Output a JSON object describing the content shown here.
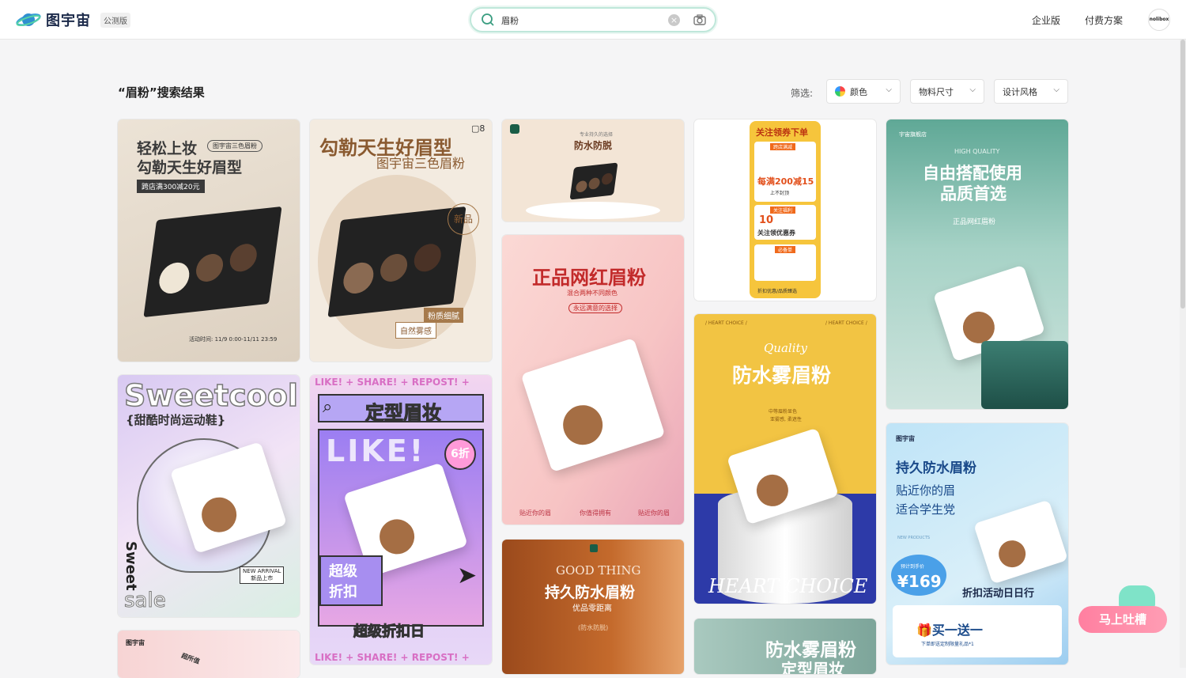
{
  "header": {
    "logo_text": "图宇宙",
    "beta_badge": "公测版",
    "search_query": "眉粉",
    "nav": [
      "企业版",
      "付费方案"
    ],
    "avatar_text": "nolibox"
  },
  "results": {
    "title": "“眉粉”搜索结果",
    "filter_label": "筛选:",
    "filters": [
      "颜色",
      "物料尺寸",
      "设计风格"
    ]
  },
  "cards": {
    "c1": {
      "title1": "轻松上妆",
      "title2": "勾勒天生好眉型",
      "tag": "图宇宙三色眉粉",
      "promo": "跨店满300减20元",
      "time": "活动时间: 11/9 0:00-11/11 23:59"
    },
    "c2": {
      "title1": "勾勒天生好眉型",
      "title2": "图宇宙三色眉粉",
      "badge": "新品",
      "label1": "粉质细腻",
      "label2": "自然雾感",
      "page_count": "8"
    },
    "c3": {
      "sub": "专业持久的选择",
      "title": "防水防脱"
    },
    "c4": {
      "head": "关注领券下单",
      "a": "跨店满减",
      "b": "每满200减15",
      "c": "上不封顶",
      "d": "关注福利",
      "e": "10",
      "f": "关注领优惠券",
      "g": "必备单",
      "h": "折扣优惠/品质臻选"
    },
    "c5": {
      "shop": "宇宙旗舰店",
      "hq": "HIGH QUALITY",
      "title1": "自由搭配使用",
      "title2": "品质首选",
      "sub": "正品网红眉粉"
    },
    "c6": {
      "title": "正品网红眉粉",
      "sub1": "混合两种不同颜色",
      "sub2": "永远满意的选择",
      "f1": "贴近你的眉",
      "f2": "你值得拥有",
      "f3": "贴近你的眉"
    },
    "c7": {
      "brand": "Sweetcool",
      "sub": "{甜酷时尚运动鞋}",
      "side": "Sweet",
      "bottom": "sale",
      "na": "NEW ARRIVAL",
      "nb": "新品上市"
    },
    "c8": {
      "top": "LIKE! + SHARE! + REPOST! +",
      "title": "定型眉妆",
      "big": "LIKE!",
      "discount": "6折",
      "b1": "超级",
      "b2": "折扣",
      "bottom": "超级折扣日",
      "repost": "REPOST!"
    },
    "c9": {
      "en": "Quality",
      "title": "防水雾眉粉",
      "sub1": "中等眉粉显色",
      "sub2": "亚雾感, 柔遮性",
      "foot": "HEART CHOICE",
      "hc": "/ HEART CHOICE /"
    },
    "c10": {
      "brand": "图宇宙",
      "title": "持久防水眉粉",
      "l1": "贴近你的眉",
      "l2": "适合学生党",
      "np": "NEW PRODUCTS",
      "price_label": "预计到手价",
      "price": "169",
      "promo": "折扣活动日日行",
      "buy": "买一送一",
      "gift": "下单即送定制限量礼品*1"
    },
    "c11": {
      "en": "GOOD THING",
      "title": "持久防水眉粉",
      "sub": "优品零距离",
      "note": "(防水防脱)"
    },
    "c12": {
      "title": "防水雾眉粉",
      "title2": "定型眉妆"
    },
    "c13": {
      "brand": "图宇宙",
      "tag": "超所值"
    }
  },
  "feedback_label": "马上吐槽"
}
